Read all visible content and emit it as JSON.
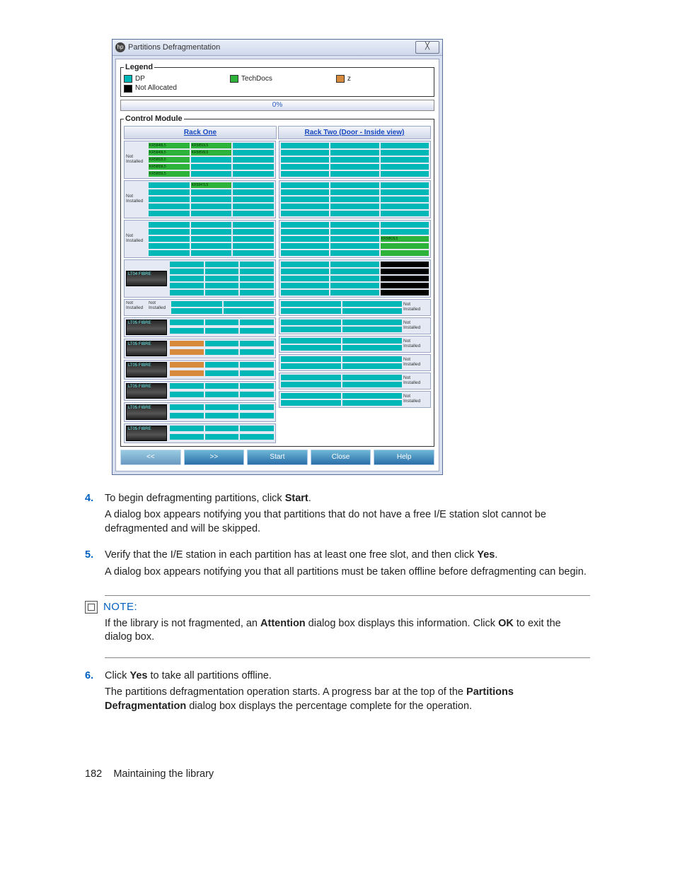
{
  "dialog": {
    "title": "Partitions Defragmentation",
    "close_glyph": "╳",
    "legend": {
      "label": "Legend",
      "items": [
        {
          "key": "dp",
          "label": "DP"
        },
        {
          "key": "td",
          "label": "TechDocs"
        },
        {
          "key": "z",
          "label": "z"
        },
        {
          "key": "na",
          "label": "Not Allocated"
        }
      ]
    },
    "progress": "0%",
    "control_label": "Control Module",
    "rack_headers": [
      "Rack One",
      "Rack Two (Door - Inside view)"
    ],
    "not_installed_label": "Not Installed",
    "slot_labels": [
      "KR5848L5",
      "KR5849L5",
      "KR5850L5",
      "KR5852L5",
      "KR5858L5",
      "KR5859L5",
      "KR5855L5",
      "KR5847L5",
      "KR5863L5"
    ],
    "drive_labels": {
      "lto4": "LT04 FIBRE",
      "lto5": "LT05 FIBRE"
    },
    "buttons": {
      "prev": "<<",
      "next": ">>",
      "start": "Start",
      "close": "Close",
      "help": "Help"
    }
  },
  "steps": {
    "s4": {
      "num": "4.",
      "line1_a": "To begin defragmenting partitions, click ",
      "line1_b": "Start",
      "line1_c": ".",
      "line2": "A dialog box appears notifying you that partitions that do not have a free I/E station slot cannot be defragmented and will be skipped."
    },
    "s5": {
      "num": "5.",
      "line1_a": "Verify that the I/E station in each partition has at least one free slot, and then click ",
      "line1_b": "Yes",
      "line1_c": ".",
      "line2": "A dialog box appears notifying you that all partitions must be taken offline before defragmenting can begin."
    },
    "s6": {
      "num": "6.",
      "line1_a": "Click ",
      "line1_b": "Yes",
      "line1_c": " to take all partitions offline.",
      "line2_a": "The partitions defragmentation operation starts. A progress bar at the top of the ",
      "line2_b": "Partitions Defragmentation",
      "line2_c": " dialog box displays the percentage complete for the operation."
    }
  },
  "note": {
    "label": "NOTE:",
    "text_a": "If the library is not fragmented, an ",
    "text_b": "Attention",
    "text_c": " dialog box displays this information. Click ",
    "text_d": "OK",
    "text_e": " to exit the dialog box."
  },
  "footer": {
    "page": "182",
    "section": "Maintaining the library"
  }
}
